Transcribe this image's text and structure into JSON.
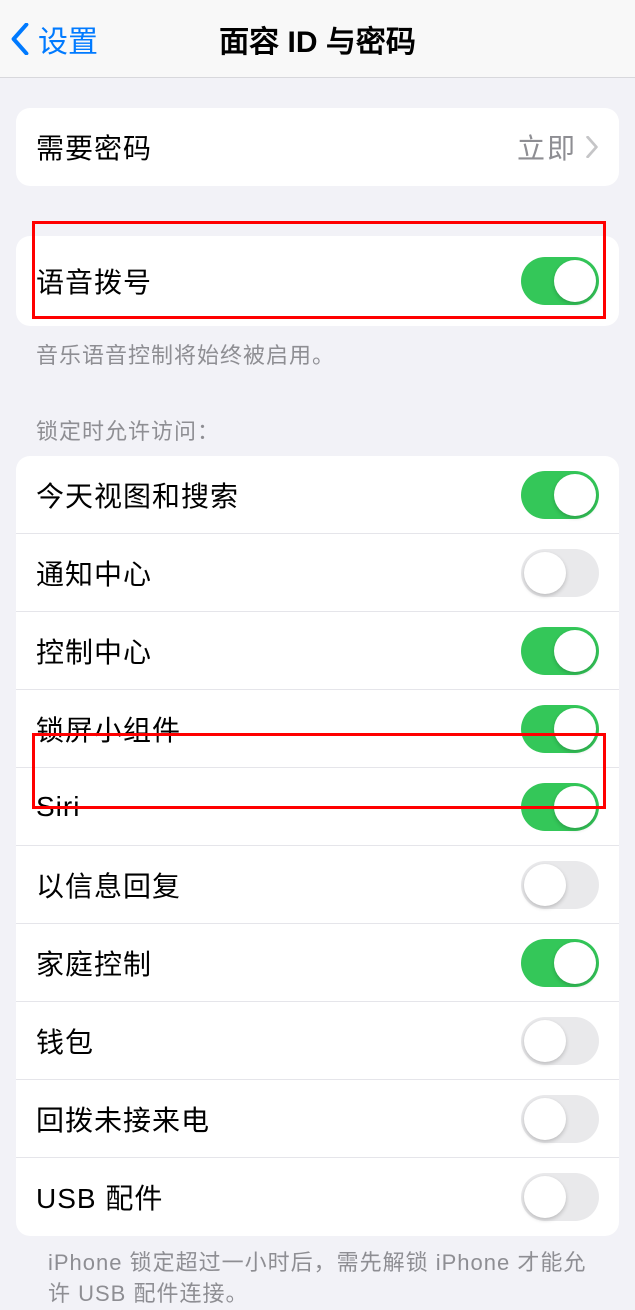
{
  "header": {
    "back_label": "设置",
    "title": "面容 ID 与密码"
  },
  "passcode": {
    "label": "需要密码",
    "value": "立即"
  },
  "voice_dial": {
    "label": "语音拨号",
    "footer": "音乐语音控制将始终被启用。"
  },
  "lock_section": {
    "header": "锁定时允许访问：",
    "items": [
      {
        "label": "今天视图和搜索",
        "on": true
      },
      {
        "label": "通知中心",
        "on": false
      },
      {
        "label": "控制中心",
        "on": true
      },
      {
        "label": "锁屏小组件",
        "on": true
      },
      {
        "label": "Siri",
        "on": true
      },
      {
        "label": "以信息回复",
        "on": false
      },
      {
        "label": "家庭控制",
        "on": true
      },
      {
        "label": "钱包",
        "on": false
      },
      {
        "label": "回拨未接来电",
        "on": false
      },
      {
        "label": "USB 配件",
        "on": false
      }
    ],
    "footer": "iPhone 锁定超过一小时后，需先解锁 iPhone 才能允许 USB 配件连接。"
  }
}
